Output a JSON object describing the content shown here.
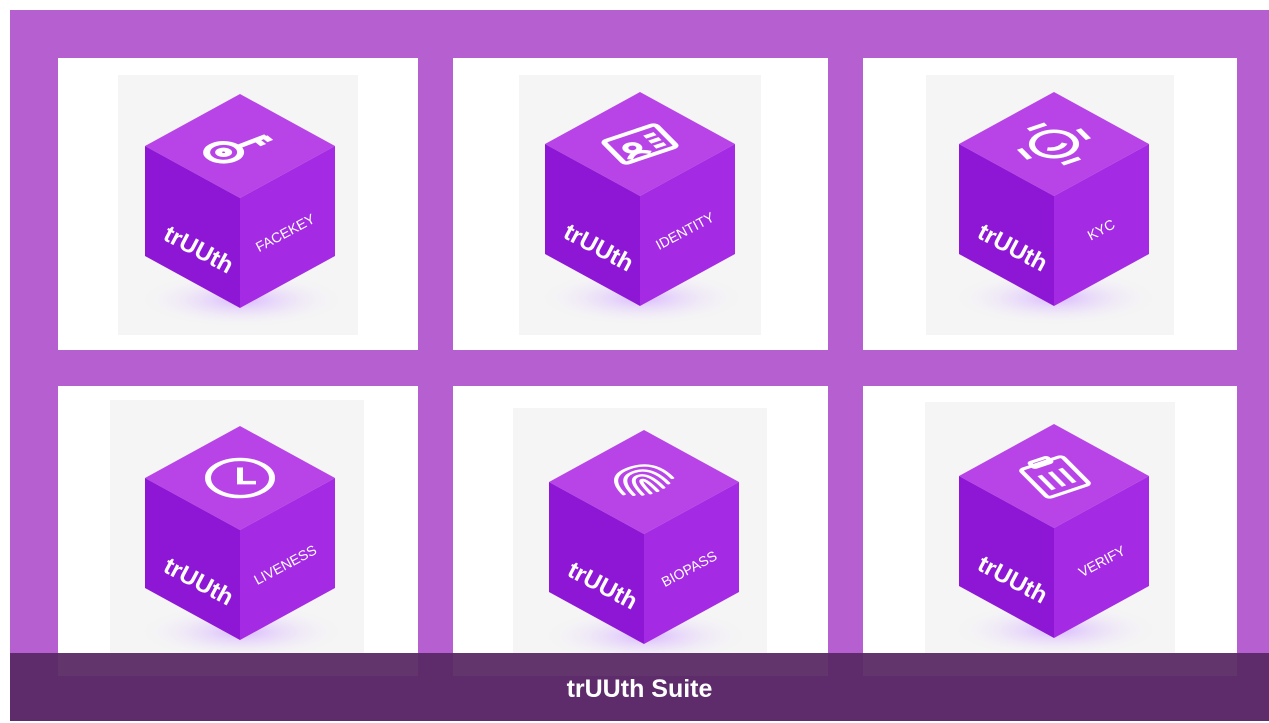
{
  "colors": {
    "frame": "#b55fd0",
    "cube_top": "#b742e8",
    "cube_left": "#8f16d6",
    "cube_right": "#a42ae2",
    "caption_bar": "#582864"
  },
  "brand_text": "trUUth",
  "products": [
    {
      "label": "FACEKEY",
      "icon": "key-icon"
    },
    {
      "label": "IDENTITY",
      "icon": "id-card-icon"
    },
    {
      "label": "KYC",
      "icon": "face-scan-icon"
    },
    {
      "label": "LIVENESS",
      "icon": "clock-icon"
    },
    {
      "label": "BIOPASS",
      "icon": "fingerprint-icon"
    },
    {
      "label": "VERIFY",
      "icon": "clipboard-icon"
    }
  ],
  "caption": "trUUth Suite"
}
